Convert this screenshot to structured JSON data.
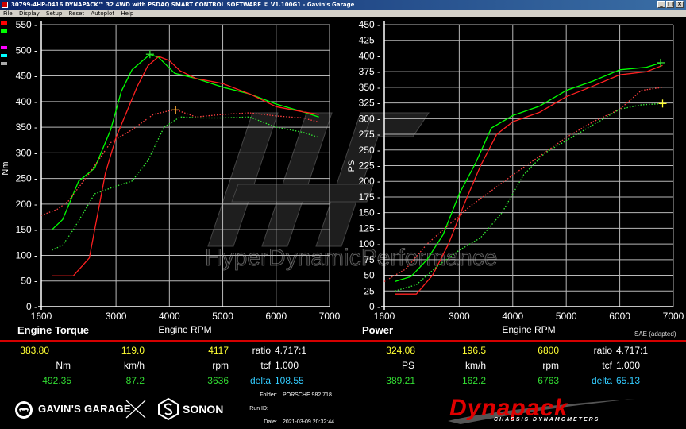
{
  "window": {
    "title": "30799-4HP-0416 DYNAPACK™ 32 4WD with PSDAQ SMART CONTROL SOFTWARE © V1.100G1 - Gavin's Garage",
    "controls": [
      "_",
      "□",
      "×"
    ]
  },
  "menu": [
    "File",
    "Display",
    "Setup",
    "Reset",
    "Autoplot",
    "Help"
  ],
  "sidebar": {
    "swatches": [
      "#ff0000",
      "#00ff00",
      "#ff00ff",
      "#00ffff",
      "#aaaaaa"
    ]
  },
  "watermark": "HyperDynamicPerformance",
  "torque_panel": {
    "title": "Engine Torque",
    "xlabel": "Engine RPM",
    "ylabel": "Nm"
  },
  "power_panel": {
    "title": "Power",
    "xlabel": "Engine RPM",
    "ylabel": "PS",
    "note": "SAE (adapted)"
  },
  "readout": {
    "left": {
      "row1": {
        "v1": "383.80",
        "v2": "119.0",
        "v3": "4117",
        "ratio_label": "ratio",
        "ratio": "4.717:1"
      },
      "row2": {
        "u1": "Nm",
        "u2": "km/h",
        "u3": "rpm",
        "tcf_label": "tcf",
        "tcf": "1.000"
      },
      "row3": {
        "v1": "492.35",
        "v2": "87.2",
        "v3": "3636",
        "delta_label": "delta",
        "delta": "108.55"
      }
    },
    "right": {
      "row1": {
        "v1": "324.08",
        "v2": "196.5",
        "v3": "6800",
        "ratio_label": "ratio",
        "ratio": "4.717:1"
      },
      "row2": {
        "u1": "PS",
        "u2": "km/h",
        "u3": "rpm",
        "tcf_label": "tcf",
        "tcf": "1.000"
      },
      "row3": {
        "v1": "389.21",
        "v2": "162.2",
        "v3": "6763",
        "delta_label": "delta",
        "delta": "65.13"
      }
    }
  },
  "meta": {
    "folder_label": "Folder:",
    "folder": "PORSCHE 982 718",
    "runid_label": "Run ID:",
    "runid": "",
    "date_label": "Date:",
    "date": "2021-03-09 20:32:44"
  },
  "brands": {
    "left": "GAVIN'S GARAGE",
    "x": "×",
    "middle": "SONON",
    "right": "Dynapack",
    "right_sub": "CHASSIS DYNAMOMETERS"
  },
  "chart_data": [
    {
      "type": "line",
      "title": "Engine Torque",
      "xlabel": "Engine RPM",
      "ylabel": "Nm",
      "xlim": [
        1600,
        7000
      ],
      "ylim": [
        0,
        550
      ],
      "xticks": [
        1600,
        3000,
        4000,
        5000,
        6000,
        7000
      ],
      "yticks": [
        0,
        50,
        100,
        150,
        200,
        250,
        300,
        350,
        400,
        450,
        500,
        550
      ],
      "grid": true,
      "series": [
        {
          "color": "#00ff00",
          "style": "solid",
          "x": [
            1800,
            2000,
            2300,
            2600,
            2900,
            3100,
            3300,
            3500,
            3636,
            3800,
            4100,
            4500,
            5000,
            5500,
            6000,
            6500,
            6800
          ],
          "y": [
            150,
            170,
            245,
            270,
            345,
            420,
            462,
            480,
            492,
            486,
            455,
            445,
            428,
            415,
            395,
            380,
            370
          ]
        },
        {
          "color": "#ff2020",
          "style": "solid",
          "x": [
            1800,
            2200,
            2500,
            2800,
            3000,
            3200,
            3400,
            3600,
            3800,
            4000,
            4200,
            4500,
            5000,
            5500,
            6000,
            6500,
            6800
          ],
          "y": [
            60,
            60,
            95,
            260,
            330,
            380,
            430,
            470,
            488,
            480,
            460,
            445,
            435,
            415,
            390,
            380,
            375
          ]
        },
        {
          "color": "#ff4040",
          "style": "dotted",
          "x": [
            1600,
            1900,
            2100,
            2500,
            2900,
            3300,
            3700,
            4000,
            4117,
            4500,
            5000,
            5500,
            6000,
            6500,
            6800
          ],
          "y": [
            178,
            190,
            205,
            260,
            320,
            345,
            375,
            382,
            384,
            370,
            375,
            378,
            372,
            368,
            360
          ]
        },
        {
          "color": "#33ee33",
          "style": "dotted",
          "x": [
            1800,
            2000,
            2200,
            2600,
            3000,
            3300,
            3600,
            3900,
            4200,
            4600,
            5000,
            5500,
            6000,
            6500,
            6800
          ],
          "y": [
            110,
            120,
            150,
            220,
            235,
            245,
            285,
            350,
            370,
            368,
            368,
            370,
            350,
            340,
            330
          ]
        }
      ]
    },
    {
      "type": "line",
      "title": "Power",
      "xlabel": "Engine RPM",
      "ylabel": "PS",
      "xlim": [
        1600,
        7000
      ],
      "ylim": [
        0,
        450
      ],
      "xticks": [
        1600,
        3000,
        4000,
        5000,
        6000,
        7000
      ],
      "yticks": [
        0,
        25,
        50,
        75,
        100,
        125,
        150,
        175,
        200,
        225,
        250,
        275,
        300,
        325,
        350,
        375,
        400,
        425,
        450
      ],
      "grid": true,
      "series": [
        {
          "color": "#00ff00",
          "style": "solid",
          "x": [
            1800,
            2100,
            2400,
            2700,
            3000,
            3300,
            3600,
            4000,
            4500,
            5000,
            5500,
            6000,
            6500,
            6763
          ],
          "y": [
            40,
            48,
            75,
            115,
            180,
            228,
            285,
            305,
            320,
            345,
            360,
            378,
            382,
            389
          ]
        },
        {
          "color": "#ff2020",
          "style": "solid",
          "x": [
            1800,
            2200,
            2500,
            2800,
            3100,
            3400,
            3700,
            4000,
            4500,
            5000,
            5500,
            6000,
            6500,
            6800
          ],
          "y": [
            20,
            20,
            50,
            100,
            165,
            225,
            275,
            295,
            310,
            335,
            352,
            370,
            375,
            385
          ]
        },
        {
          "color": "#ff4040",
          "style": "dotted",
          "x": [
            1600,
            2000,
            2400,
            2800,
            3200,
            3600,
            4000,
            4500,
            5000,
            5500,
            6000,
            6400,
            6800
          ],
          "y": [
            40,
            60,
            100,
            130,
            160,
            185,
            210,
            240,
            270,
            295,
            315,
            345,
            350
          ]
        },
        {
          "color": "#33ee33",
          "style": "dotted",
          "x": [
            1800,
            2200,
            2600,
            3000,
            3400,
            3800,
            4200,
            4600,
            5000,
            5500,
            6000,
            6400,
            6800
          ],
          "y": [
            25,
            35,
            65,
            90,
            110,
            150,
            210,
            245,
            265,
            290,
            315,
            322,
            324
          ]
        }
      ]
    }
  ]
}
